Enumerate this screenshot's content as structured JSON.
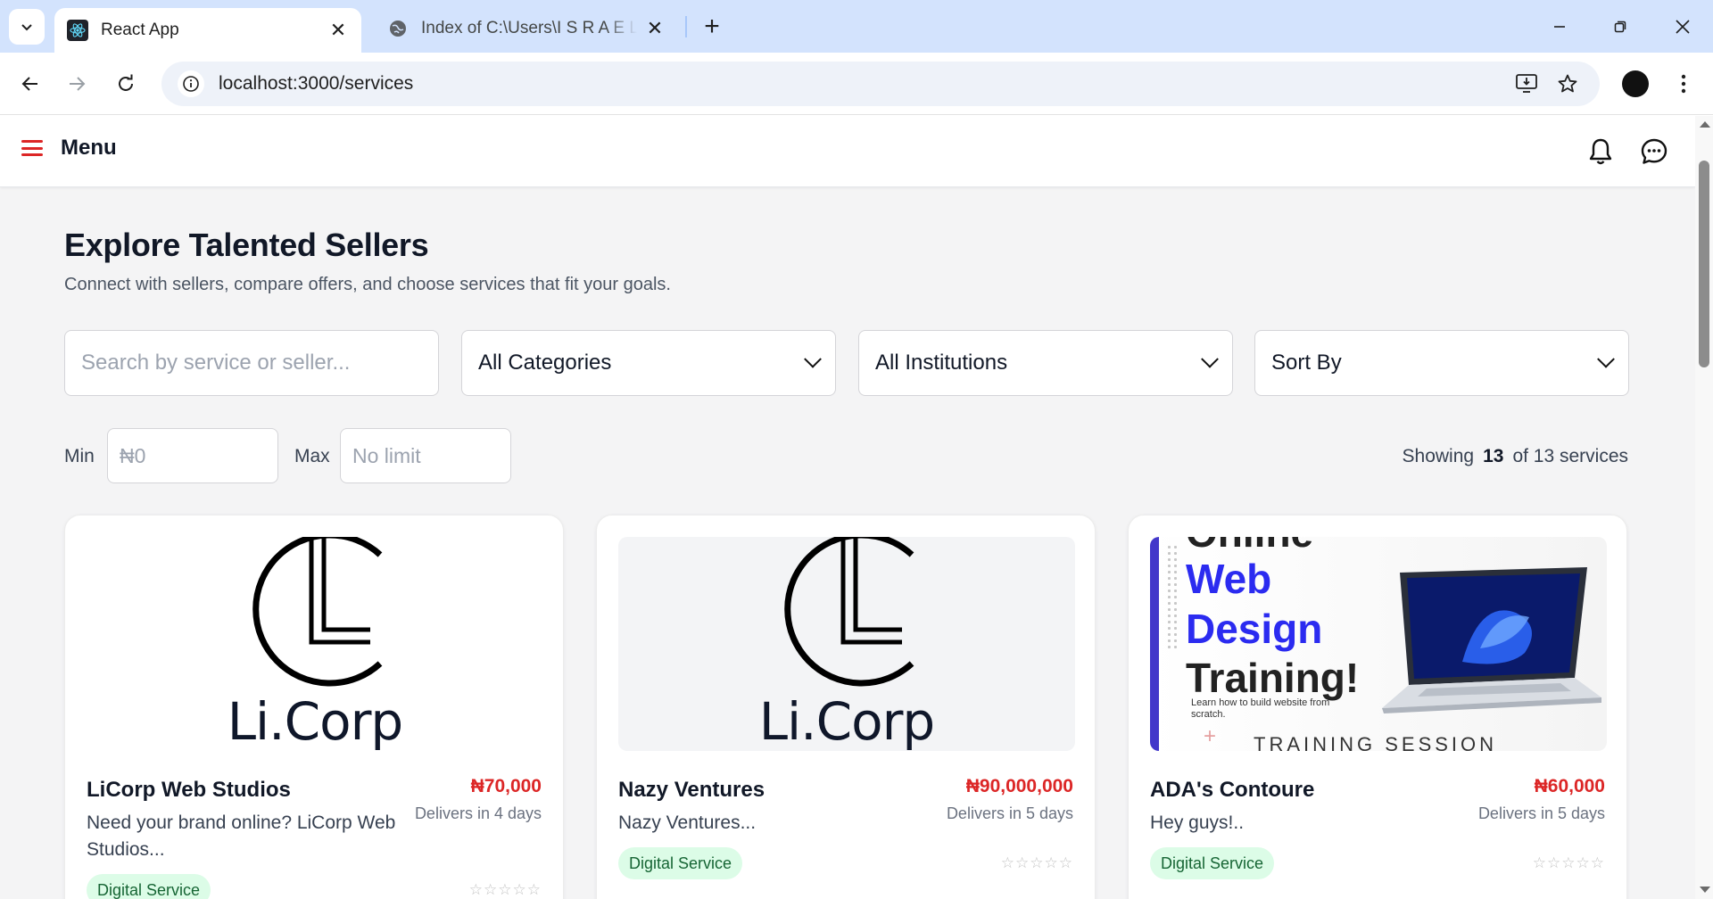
{
  "browser": {
    "tabs": [
      {
        "title": "React App",
        "active": true,
        "favicon": "react-icon"
      },
      {
        "title": "Index of C:\\Users\\I S R A E L\\De",
        "active": false,
        "favicon": "globe-icon"
      }
    ],
    "url": "localhost:3000/services"
  },
  "header": {
    "menu_label": "Menu",
    "accent_color": "#dc2626"
  },
  "page": {
    "title": "Explore Talented Sellers",
    "subtitle": "Connect with sellers, compare offers, and choose services that fit your goals."
  },
  "filters": {
    "search_placeholder": "Search by service or seller...",
    "category_selected": "All Categories",
    "institution_selected": "All Institutions",
    "sort_selected": "Sort By",
    "min_label": "Min",
    "min_placeholder": "₦0",
    "max_label": "Max",
    "max_placeholder": "No limit"
  },
  "results": {
    "prefix": "Showing",
    "count": "13",
    "suffix": "of 13 services"
  },
  "cards": [
    {
      "name": "LiCorp Web Studios",
      "price": "₦70,000",
      "delivery": "Delivers in 4 days",
      "description": "Need your brand online? LiCorp Web Studios...",
      "badge": "Digital Service",
      "stars": "☆☆☆☆☆",
      "logo_text": "Li.Corp"
    },
    {
      "name": "Nazy Ventures",
      "price": "₦90,000,000",
      "delivery": "Delivers in 5 days",
      "description": "Nazy Ventures...",
      "badge": "Digital Service",
      "stars": "☆☆☆☆☆",
      "logo_text": "Li.Corp"
    },
    {
      "name": "ADA's Contoure",
      "price": "₦60,000",
      "delivery": "Delivers in 5 days",
      "description": "Hey guys!..",
      "badge": "Digital Service",
      "stars": "☆☆☆☆☆",
      "promo": {
        "line0": "Online",
        "line1": "Web",
        "line2": "Design",
        "line3": "Training!",
        "small": "Learn how to build website from scratch.",
        "session": "TRAINING SESSION",
        "accent": "#2b2bf0"
      }
    }
  ]
}
